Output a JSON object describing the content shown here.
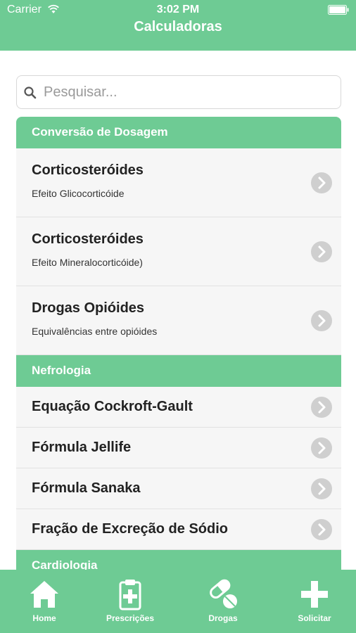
{
  "status_bar": {
    "carrier": "Carrier",
    "time": "3:02 PM"
  },
  "nav": {
    "title": "Calculadoras"
  },
  "search": {
    "placeholder": "Pesquisar..."
  },
  "sections": [
    {
      "header": "Conversão de Dosagem",
      "items": [
        {
          "title": "Corticosteróides",
          "subtitle": "Efeito Glicocorticóide"
        },
        {
          "title": "Corticosteróides",
          "subtitle": "Efeito Mineralocorticóide)"
        },
        {
          "title": "Drogas Opióides",
          "subtitle": "Equivalências entre opióides"
        }
      ]
    },
    {
      "header": "Nefrologia",
      "items": [
        {
          "title": "Equação Cockroft-Gault"
        },
        {
          "title": "Fórmula Jellife"
        },
        {
          "title": "Fórmula Sanaka"
        },
        {
          "title": "Fração de Excreção de Sódio"
        }
      ]
    },
    {
      "header": "Cardiologia"
    }
  ],
  "tabbar": {
    "tabs": [
      {
        "label": "Home",
        "icon": "home-icon"
      },
      {
        "label": "Prescrições",
        "icon": "clipboard-icon"
      },
      {
        "label": "Drogas",
        "icon": "pills-icon"
      },
      {
        "label": "Solicitar",
        "icon": "plus-icon"
      }
    ]
  },
  "colors": {
    "accent": "#6ecb94",
    "row_bg": "#f6f6f6",
    "chevron": "#cfcfcf"
  }
}
